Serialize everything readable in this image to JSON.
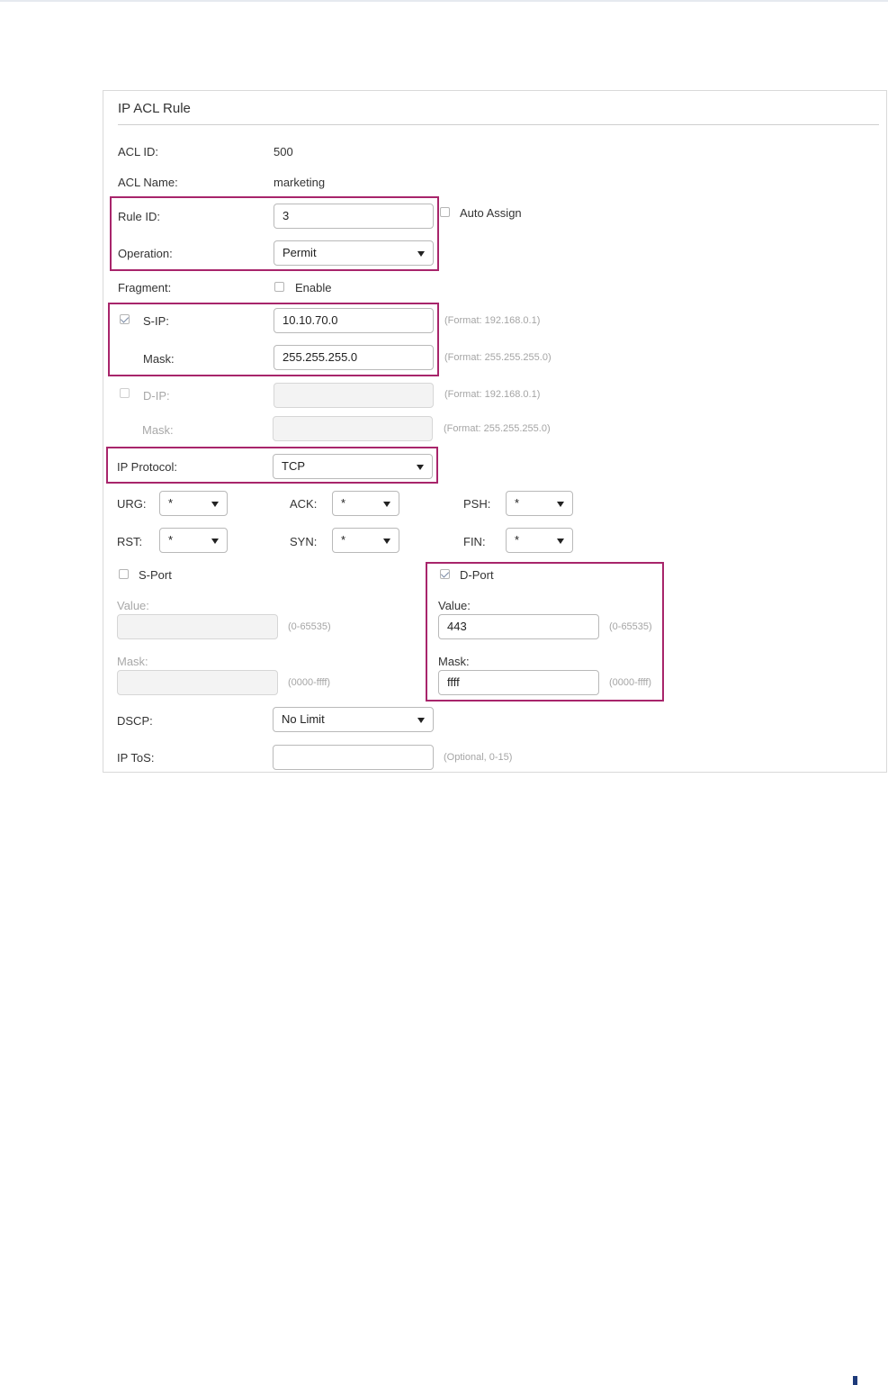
{
  "form": {
    "title": "IP ACL Rule",
    "acl_id_label": "ACL ID:",
    "acl_id_value": "500",
    "acl_name_label": "ACL Name:",
    "acl_name_value": "marketing",
    "rule_id_label": "Rule ID:",
    "rule_id_value": "3",
    "auto_assign_label": "Auto Assign",
    "auto_assign_checked": false,
    "operation_label": "Operation:",
    "operation_value": "Permit",
    "fragment_label": "Fragment:",
    "fragment_enable_label": "Enable",
    "fragment_checked": false,
    "sip_label": "S-IP:",
    "sip_checked": true,
    "sip_value": "10.10.70.0",
    "sip_hint": "(Format: 192.168.0.1)",
    "sip_mask_label": "Mask:",
    "sip_mask_value": "255.255.255.0",
    "sip_mask_hint": "(Format: 255.255.255.0)",
    "dip_label": "D-IP:",
    "dip_checked": false,
    "dip_value": "",
    "dip_hint": "(Format: 192.168.0.1)",
    "dip_mask_label": "Mask:",
    "dip_mask_value": "",
    "dip_mask_hint": "(Format: 255.255.255.0)",
    "ip_protocol_label": "IP Protocol:",
    "ip_protocol_value": "TCP",
    "flags": [
      {
        "label": "URG:",
        "value": "*"
      },
      {
        "label": "ACK:",
        "value": "*"
      },
      {
        "label": "PSH:",
        "value": "*"
      },
      {
        "label": "RST:",
        "value": "*"
      },
      {
        "label": "SYN:",
        "value": "*"
      },
      {
        "label": "FIN:",
        "value": "*"
      }
    ],
    "sport_label": "S-Port",
    "sport_checked": false,
    "sport_value_label": "Value:",
    "sport_value": "",
    "sport_value_hint": "(0-65535)",
    "sport_mask_label": "Mask:",
    "sport_mask_value": "",
    "sport_mask_hint": "(0000-ffff)",
    "dport_label": "D-Port",
    "dport_checked": true,
    "dport_value_label": "Value:",
    "dport_value": "443",
    "dport_value_hint": "(0-65535)",
    "dport_mask_label": "Mask:",
    "dport_mask_value": "ffff",
    "dport_mask_hint": "(0000-ffff)",
    "dscp_label": "DSCP:",
    "dscp_value": "No Limit",
    "ip_tos_label": "IP ToS:",
    "ip_tos_value": "",
    "ip_tos_hint": "(Optional, 0-15)"
  },
  "colors": {
    "highlight_box": "#a8256b",
    "input_border": "#b9b9b9",
    "disabled_bg": "#f3f3f3",
    "hint_text": "#a5a5a5",
    "corner_mark": "#1d3a7a"
  }
}
